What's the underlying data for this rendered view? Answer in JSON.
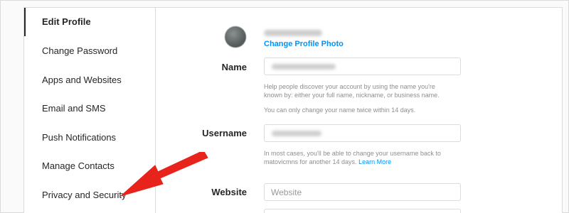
{
  "sidebar": {
    "items": [
      {
        "label": "Edit Profile"
      },
      {
        "label": "Change Password"
      },
      {
        "label": "Apps and Websites"
      },
      {
        "label": "Email and SMS"
      },
      {
        "label": "Push Notifications"
      },
      {
        "label": "Manage Contacts"
      },
      {
        "label": "Privacy and Security"
      }
    ]
  },
  "profile": {
    "change_photo_label": "Change Profile Photo"
  },
  "form": {
    "name_label": "Name",
    "name_hint": "Help people discover your account by using the name you're known by: either your full name, nickname, or business name.",
    "name_change_note": "You can only change your name twice within 14 days.",
    "username_label": "Username",
    "username_hint": "In most cases, you'll be able to change your username back to matovicmns for another 14 days.",
    "learn_more": "Learn More",
    "website_label": "Website",
    "website_placeholder": "Website"
  },
  "annotation": {
    "arrow_color": "#e8231b"
  },
  "colors": {
    "link": "#0095f6",
    "border": "#dbdbdb",
    "background": "#fafafa"
  }
}
